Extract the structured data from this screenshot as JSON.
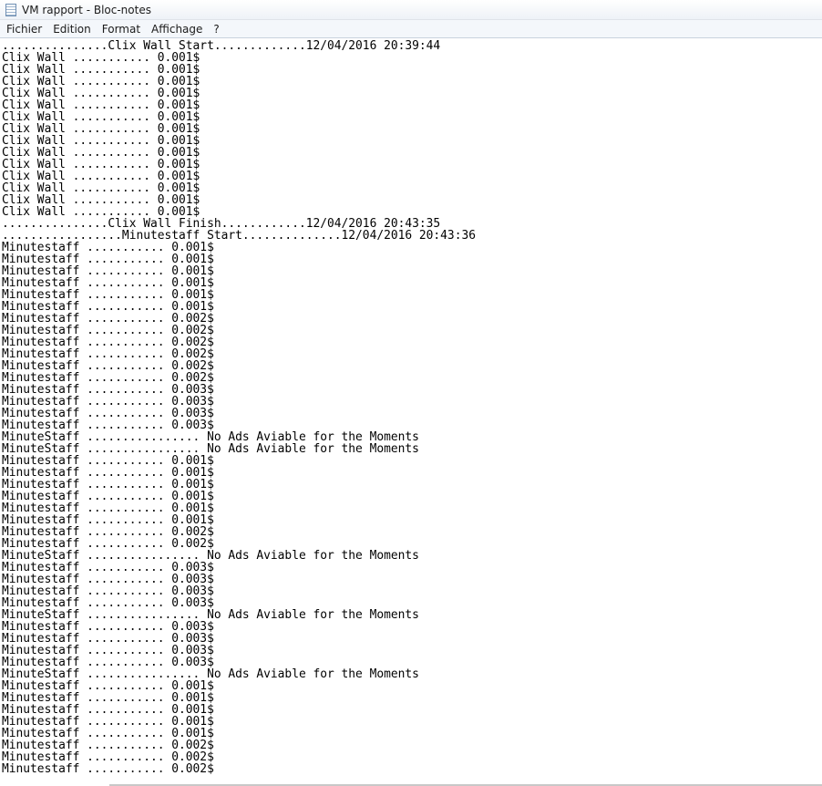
{
  "window": {
    "title": "VM rapport - Bloc-notes",
    "icon": "notepad-icon"
  },
  "menu": {
    "items": [
      {
        "label": "Fichier",
        "name": "menu-fichier"
      },
      {
        "label": "Edition",
        "name": "menu-edition"
      },
      {
        "label": "Format",
        "name": "menu-format"
      },
      {
        "label": "Affichage",
        "name": "menu-affichage"
      },
      {
        "label": "?",
        "name": "menu-help"
      }
    ]
  },
  "document": {
    "lines": [
      "...............Clix Wall Start.............12/04/2016 20:39:44",
      "Clix Wall ........... 0.001$",
      "Clix Wall ........... 0.001$",
      "Clix Wall ........... 0.001$",
      "Clix Wall ........... 0.001$",
      "Clix Wall ........... 0.001$",
      "Clix Wall ........... 0.001$",
      "Clix Wall ........... 0.001$",
      "Clix Wall ........... 0.001$",
      "Clix Wall ........... 0.001$",
      "Clix Wall ........... 0.001$",
      "Clix Wall ........... 0.001$",
      "Clix Wall ........... 0.001$",
      "Clix Wall ........... 0.001$",
      "Clix Wall ........... 0.001$",
      "...............Clix Wall Finish............12/04/2016 20:43:35",
      ".................Minutestaff Start..............12/04/2016 20:43:36",
      "Minutestaff ........... 0.001$",
      "Minutestaff ........... 0.001$",
      "Minutestaff ........... 0.001$",
      "Minutestaff ........... 0.001$",
      "Minutestaff ........... 0.001$",
      "Minutestaff ........... 0.001$",
      "Minutestaff ........... 0.002$",
      "Minutestaff ........... 0.002$",
      "Minutestaff ........... 0.002$",
      "Minutestaff ........... 0.002$",
      "Minutestaff ........... 0.002$",
      "Minutestaff ........... 0.002$",
      "Minutestaff ........... 0.003$",
      "Minutestaff ........... 0.003$",
      "Minutestaff ........... 0.003$",
      "Minutestaff ........... 0.003$",
      "MinuteStaff ................ No Ads Aviable for the Moments",
      "MinuteStaff ................ No Ads Aviable for the Moments",
      "Minutestaff ........... 0.001$",
      "Minutestaff ........... 0.001$",
      "Minutestaff ........... 0.001$",
      "Minutestaff ........... 0.001$",
      "Minutestaff ........... 0.001$",
      "Minutestaff ........... 0.001$",
      "Minutestaff ........... 0.002$",
      "Minutestaff ........... 0.002$",
      "MinuteStaff ................ No Ads Aviable for the Moments",
      "Minutestaff ........... 0.003$",
      "Minutestaff ........... 0.003$",
      "Minutestaff ........... 0.003$",
      "Minutestaff ........... 0.003$",
      "MinuteStaff ................ No Ads Aviable for the Moments",
      "Minutestaff ........... 0.003$",
      "Minutestaff ........... 0.003$",
      "Minutestaff ........... 0.003$",
      "Minutestaff ........... 0.003$",
      "MinuteStaff ................ No Ads Aviable for the Moments",
      "Minutestaff ........... 0.001$",
      "Minutestaff ........... 0.001$",
      "Minutestaff ........... 0.001$",
      "Minutestaff ........... 0.001$",
      "Minutestaff ........... 0.001$",
      "Minutestaff ........... 0.002$",
      "Minutestaff ........... 0.002$",
      "Minutestaff ........... 0.002$"
    ]
  }
}
